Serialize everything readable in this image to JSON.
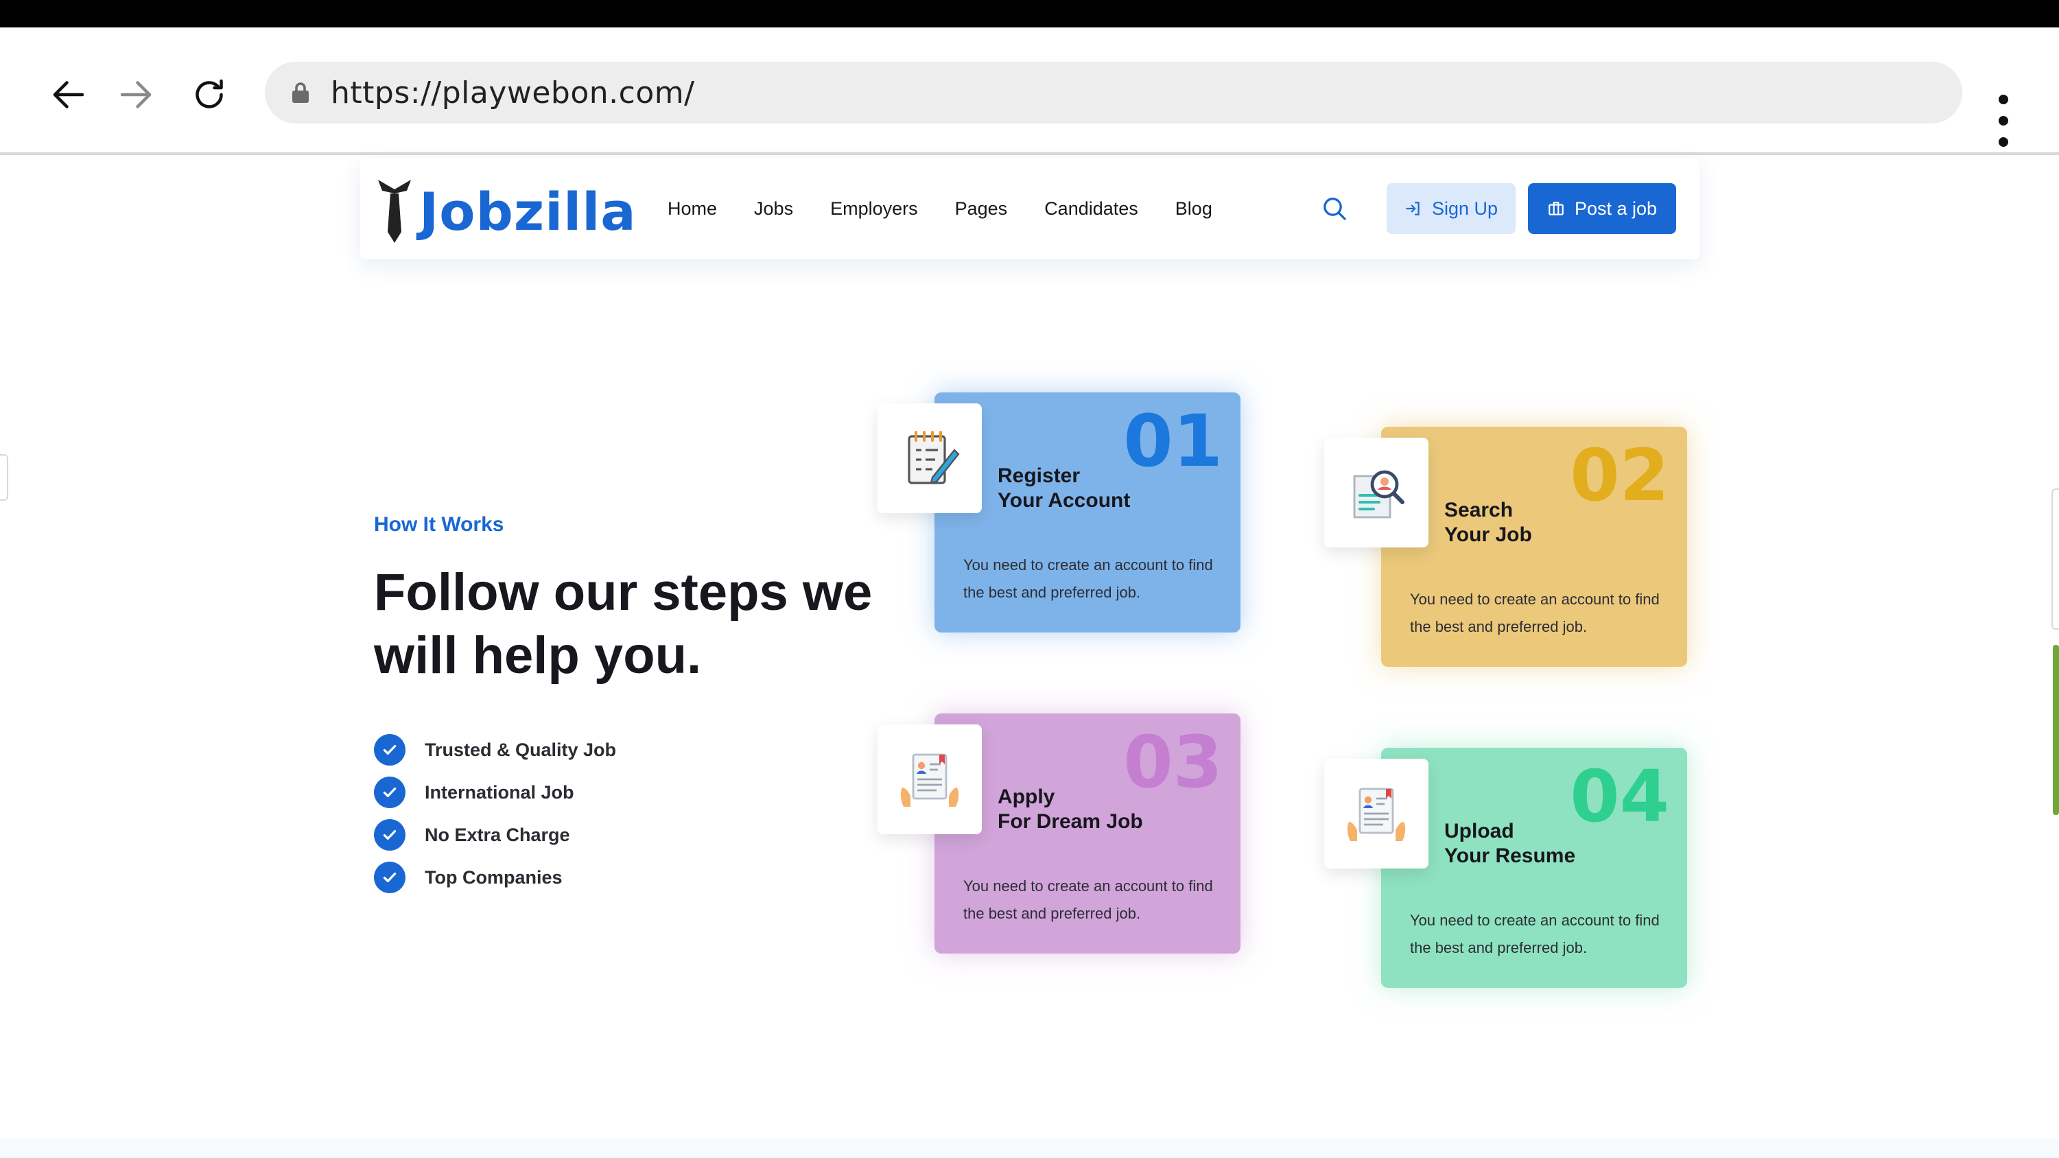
{
  "browser": {
    "url": "https://playwebon.com/"
  },
  "header": {
    "logo_text": "Jobzilla",
    "nav": [
      "Home",
      "Jobs",
      "Employers",
      "Pages",
      "Candidates",
      "Blog"
    ],
    "signup_label": "Sign Up",
    "post_job_label": "Post a job"
  },
  "hero": {
    "eyebrow": "How It Works",
    "headline": "Follow our steps we will help you.",
    "features": [
      "Trusted & Quality Job",
      "International Job",
      "No Extra Charge",
      "Top Companies"
    ]
  },
  "steps": [
    {
      "number": "01",
      "title": "Register\nYour Account",
      "description": "You need to create an account to find the best and preferred job."
    },
    {
      "number": "02",
      "title": "Search\nYour Job",
      "description": "You need to create an account to find the best and preferred job."
    },
    {
      "number": "03",
      "title": "Apply\nFor Dream Job",
      "description": "You need to create an account to find the best and preferred job."
    },
    {
      "number": "04",
      "title": "Upload\nYour Resume",
      "description": "You need to create an account to find the best and preferred job."
    }
  ],
  "colors": {
    "brand": "#1967d2",
    "card1": "#7eb3e9",
    "card2": "#ebc87a",
    "card3": "#d1a4da",
    "card4": "#8ee2c1"
  }
}
